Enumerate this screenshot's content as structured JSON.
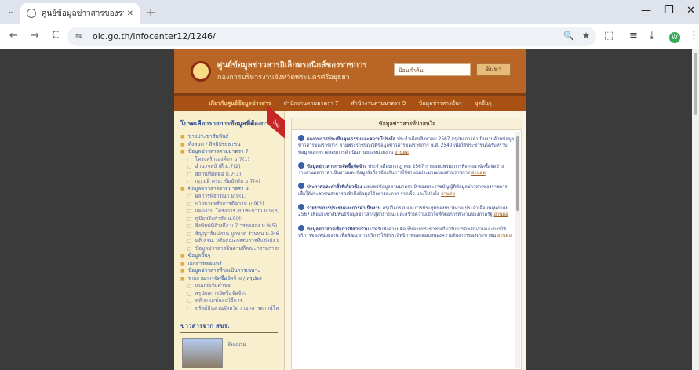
{
  "browser": {
    "tab": {
      "title": "ศูนย์ข้อมูลข่าวสารของราชการ » oai",
      "close": "✕"
    },
    "new_tab": "+",
    "window_controls": [
      "—",
      "❐",
      "✕"
    ],
    "nav": {
      "back": "←",
      "forward": "→",
      "reload": "C"
    },
    "address": "oic.go.th/infocenter12/1246/",
    "omnibox_icons": [
      "🔍",
      "★"
    ],
    "toolbar_icons": [
      "⬚",
      "≡",
      "⤓",
      "⋮"
    ],
    "profile_letter": "W"
  },
  "site": {
    "title": "ศูนย์ข้อมูลข่าวสารอิเล็กทรอนิกส์ของราชการ",
    "subtitle": "กองการบริหารงานจังหวัดพระนครศรีอยุธยา",
    "search_placeholder": "ป้อนคำค้น",
    "search_button": "ค้นหา",
    "menu": [
      "เกี่ยวกับศูนย์ข้อมูลข่าวสาร",
      "สำนักงานตามมาตรา 7",
      "สำนักงานตามมาตรา 9",
      "ข้อมูลข่าวสารอื่นๆ",
      "ชุดอื่นๆ"
    ]
  },
  "sidebar": {
    "title": "โปรดเลือกรายการข้อมูลที่ต้องการ",
    "ribbon": "ใหม่",
    "items": [
      {
        "label": "ข่าวประชาสัมพันธ์",
        "level": 1
      },
      {
        "label": "ทั้งหมด / สิทธิประชาชน",
        "level": 1
      },
      {
        "label": "ข้อมูลข่าวสารตามมาตรา 7",
        "level": 1
      },
      {
        "label": "โครงสร้างองค์กร ม.7(1)",
        "level": 2
      },
      {
        "label": "อำนาจหน้าที่ ม.7(2)",
        "level": 2
      },
      {
        "label": "สถานที่ติดต่อ ม.7(3)",
        "level": 2
      },
      {
        "label": "กฎ มติ ครม. ข้อบังคับ ม.7(4)",
        "level": 2
      },
      {
        "label": "ข้อมูลข่าวสารตามมาตรา 9",
        "level": 1
      },
      {
        "label": "ผลการพิจารณา ม.9(1)",
        "level": 2
      },
      {
        "label": "นโยบายหรือการตีความ ม.9(2)",
        "level": 2
      },
      {
        "label": "แผนงาน โครงการ งบประมาณ ม.9(3)",
        "level": 2
      },
      {
        "label": "คู่มือหรือคำสั่ง ม.9(4)",
        "level": 2
      },
      {
        "label": "สิ่งพิมพ์ที่อ้างถึง ม.7 วรรคสอง ม.9(5)",
        "level": 2
      },
      {
        "label": "สัญญาสัมปทาน ผูกขาด ร่วมทุน ม.9(6)",
        "level": 2
      },
      {
        "label": "มติ ครม. หรือคณะกรรมการที่แต่งตั้ง ม.9(7)",
        "level": 2
      },
      {
        "label": "ข้อมูลข่าวสารอื่นตามที่คณะกรรมการกำหนด ม.9(8)",
        "level": 2
      },
      {
        "label": "ข้อมูลอื่นๆ",
        "level": 1
      },
      {
        "label": "เอกสารเผยแพร่",
        "level": 1
      },
      {
        "label": "ข้อมูลข่าวสารที่ขอเป็นการเฉพาะ",
        "level": 1
      },
      {
        "label": "รายงานการจัดซื้อจัดจ้าง / สรุปผล",
        "level": 1
      },
      {
        "label": "แบบฟอร์มคำขอ",
        "level": 2
      },
      {
        "label": "สรุปผลการจัดซื้อจัดจ้าง",
        "level": 2
      },
      {
        "label": "หลักเกณฑ์และวิธีการ",
        "level": 2
      },
      {
        "label": "ทรัพย์สินส่วนจังหวัด / เอกสารดาวน์โหลด",
        "level": 2
      }
    ],
    "news_title": "ข่าวสารจาก สขร.",
    "news_link": "จัดอบรม"
  },
  "main": {
    "heading": "ข้อมูลข่าวสารที่น่าสนใจ",
    "articles": [
      {
        "first": "ผลงานการประเมินคุณธรรมและความโปร่งใส",
        "text": "ประจำเดือนสิงหาคม 2567 สรุปผลการดำเนินงานด้านข้อมูลข่าวสารของราชการ ตามพระราชบัญญัติข้อมูลข่าวสารของราชการ พ.ศ. 2540 เพื่อให้ประชาชนได้รับทราบข้อมูลและตรวจสอบการดำเนินงานของหน่วยงาน",
        "more": "อ่านต่อ"
      },
      {
        "first": "ข้อมูลข่าวสารการจัดซื้อจัดจ้าง",
        "text": "ประจำเดือนกรกฎาคม 2567 การเผยแพร่ผลการพิจารณาจัดซื้อจัดจ้าง รายงานผลการดำเนินงานและข้อมูลที่เกี่ยวข้องกับการใช้จ่ายงบประมาณของส่วนราชการ",
        "more": "อ่านต่อ"
      },
      {
        "first": "ประกาศและคำสั่งที่เกี่ยวข้อง",
        "text": "เผยแพร่ข้อมูลตามมาตรา 9 ของพระราชบัญญัติข้อมูลข่าวสารของราชการ เพื่อให้ประชาชนสามารถเข้าถึงข้อมูลได้อย่างสะดวก รวดเร็ว และโปร่งใส",
        "more": "อ่านต่อ"
      },
      {
        "first": "รายงานการประชุมและการดำเนินงาน",
        "text": "สรุปกิจกรรมและการประชุมของหน่วยงาน ประจำเดือนพฤษภาคม 2567 เพื่อประชาสัมพันธ์ข้อมูลข่าวสารสู่สาธารณะและสร้างความเข้าใจที่ดีต่อการทำงานของภาครัฐ",
        "more": "อ่านต่อ"
      },
      {
        "first": "ข้อมูลข่าวสารเพื่อการมีส่วนร่วม",
        "text": "เปิดรับฟังความคิดเห็นจากประชาชนเกี่ยวกับการดำเนินงานและการให้บริการของหน่วยงาน เพื่อพัฒนาการบริการให้มีประสิทธิภาพและตอบสนองความต้องการของประชาชน",
        "more": "อ่านต่อ"
      }
    ]
  }
}
